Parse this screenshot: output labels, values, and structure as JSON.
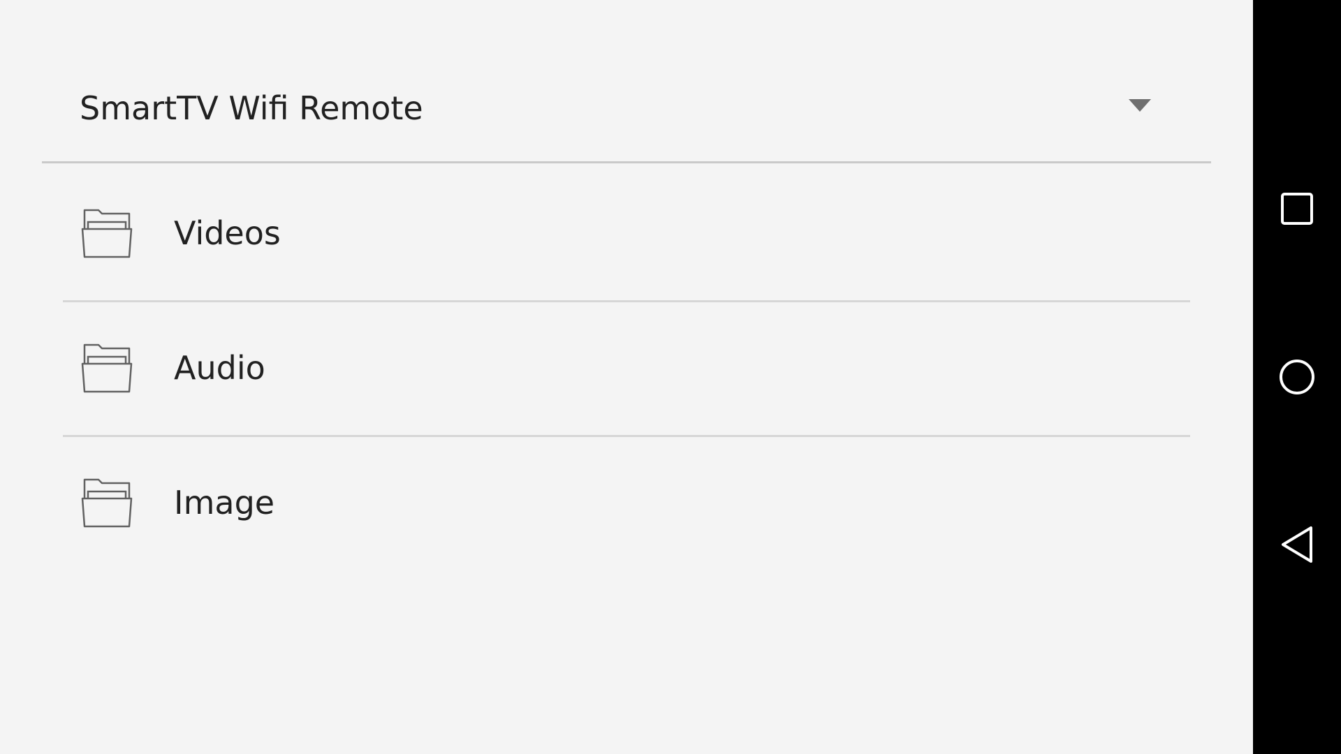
{
  "app": {
    "device_selector": {
      "selected": "SmartTV Wifi Remote",
      "arrow_icon": "dropdown-arrow-icon"
    },
    "folders": [
      {
        "label": "Videos",
        "icon": "folder-open-icon"
      },
      {
        "label": "Audio",
        "icon": "folder-open-icon"
      },
      {
        "label": "Image",
        "icon": "folder-open-icon"
      }
    ]
  },
  "navigation_bar": {
    "buttons": [
      {
        "name": "recents",
        "icon": "square-icon"
      },
      {
        "name": "home",
        "icon": "circle-icon"
      },
      {
        "name": "back",
        "icon": "triangle-back-icon"
      }
    ]
  },
  "colors": {
    "background": "#f4f4f4",
    "text": "#212121",
    "icon": "#616161",
    "divider": "#d6d6d6",
    "navbar": "#000000",
    "navbar_icon": "#ffffff"
  }
}
